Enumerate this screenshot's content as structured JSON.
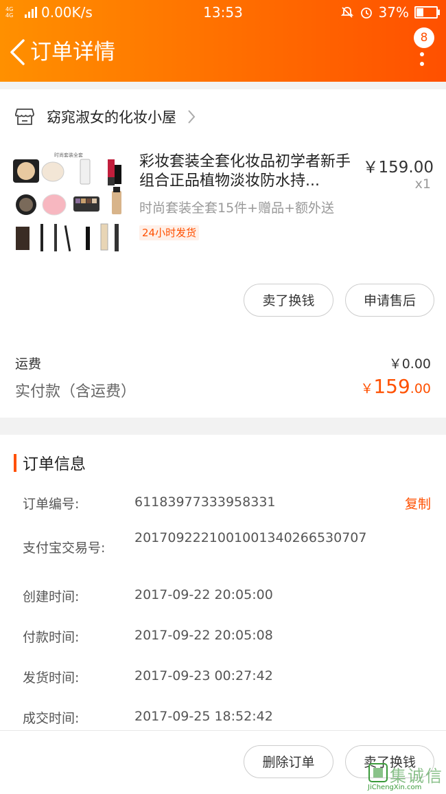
{
  "status_bar": {
    "network": "4G 4G",
    "speed": "0.00K/s",
    "time": "13:53",
    "battery": "37%",
    "battery_level": 0.37
  },
  "header": {
    "title": "订单详情",
    "badge_count": "8",
    "back_icon": "chevron-left-icon",
    "more_icon": "more-vertical-icon"
  },
  "shop": {
    "name": "窈窕淑女的化妆小屋",
    "icon": "store-icon"
  },
  "product": {
    "title": "彩妆套装全套化妆品初学者新手组合正品植物淡妆防水持...",
    "price": "￥159.00",
    "qty": "x1",
    "spec": "时尚套装全套15件+赠品+额外送",
    "tag": "24小时发货",
    "image_caption": "时尚套装全套"
  },
  "item_actions": {
    "sell_label": "卖了换钱",
    "after_sale_label": "申请售后"
  },
  "summary": {
    "shipping_label": "运费",
    "shipping_value": "￥0.00",
    "paid_label": "实付款（含运费）",
    "paid_symbol": "￥",
    "paid_int": "159",
    "paid_dec": ".00"
  },
  "order_info": {
    "title": "订单信息",
    "copy_label": "复制",
    "rows": [
      {
        "label": "订单编号:",
        "value": "61183977333958331"
      },
      {
        "label": "支付宝交易号:",
        "value": "2017092221001001340266530707"
      },
      {
        "label": "创建时间:",
        "value": "2017-09-22 20:05:00"
      },
      {
        "label": "付款时间:",
        "value": "2017-09-22 20:05:08"
      },
      {
        "label": "发货时间:",
        "value": "2017-09-23 00:27:42"
      },
      {
        "label": "成交时间:",
        "value": "2017-09-25 18:52:42"
      }
    ]
  },
  "bottom": {
    "delete_label": "删除订单",
    "sell_label": "卖了换钱"
  },
  "watermark": {
    "name": "集诚信",
    "url": "JiChengXin.com"
  },
  "colors": {
    "accent": "#ff5000",
    "header_start": "#ff9000",
    "header_end": "#ff5000"
  }
}
